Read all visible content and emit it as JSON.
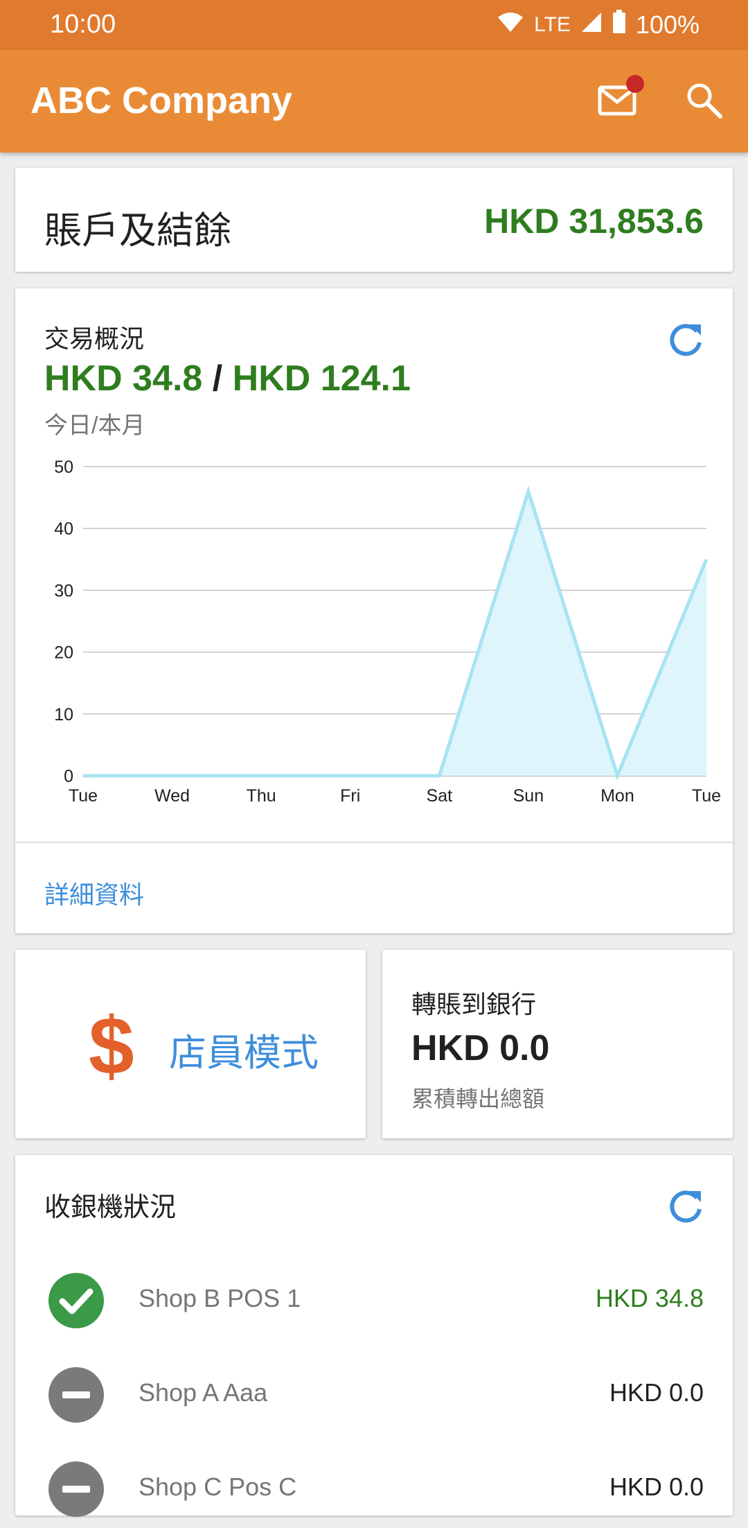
{
  "status_bar": {
    "time": "10:00",
    "network": "LTE",
    "battery": "100%"
  },
  "app_bar": {
    "title": "ABC Company"
  },
  "balance": {
    "label": "賬戶及結餘",
    "value": "HKD 31,853.6"
  },
  "transactions": {
    "title": "交易概況",
    "today": "HKD 34.8",
    "separator": " / ",
    "month": "HKD 124.1",
    "subtitle": "今日/本月",
    "details_label": "詳細資料"
  },
  "chart_data": {
    "type": "area",
    "categories": [
      "Tue",
      "Wed",
      "Thu",
      "Fri",
      "Sat",
      "Sun",
      "Mon",
      "Tue"
    ],
    "values": [
      0,
      0,
      0,
      0,
      0,
      46,
      0,
      35
    ],
    "ylim": [
      0,
      50
    ],
    "yticks": [
      0,
      10,
      20,
      30,
      40,
      50
    ],
    "grid": true,
    "line_color": "#a7e3f3",
    "fill_color": "#dff5fc"
  },
  "staff_mode": {
    "label": "店員模式",
    "icon": "dollar-icon"
  },
  "bank_transfer": {
    "title": "轉賬到銀行",
    "value": "HKD 0.0",
    "subtitle": "累積轉出總額"
  },
  "pos_status": {
    "title": "收銀機狀況",
    "items": [
      {
        "name": "Shop B POS 1",
        "amount": "HKD 34.8",
        "status": "active"
      },
      {
        "name": "Shop A Aaa",
        "amount": "HKD 0.0",
        "status": "inactive"
      },
      {
        "name": "Shop C Pos C",
        "amount": "HKD 0.0",
        "status": "inactive"
      }
    ]
  },
  "colors": {
    "status_bar": "#e07a2e",
    "app_bar": "#e98b36",
    "positive": "#2e7d1e",
    "link": "#3e8edb",
    "dollar": "#e4602a",
    "check": "#3a9a47",
    "inactive_icon": "#7a7a7a"
  }
}
